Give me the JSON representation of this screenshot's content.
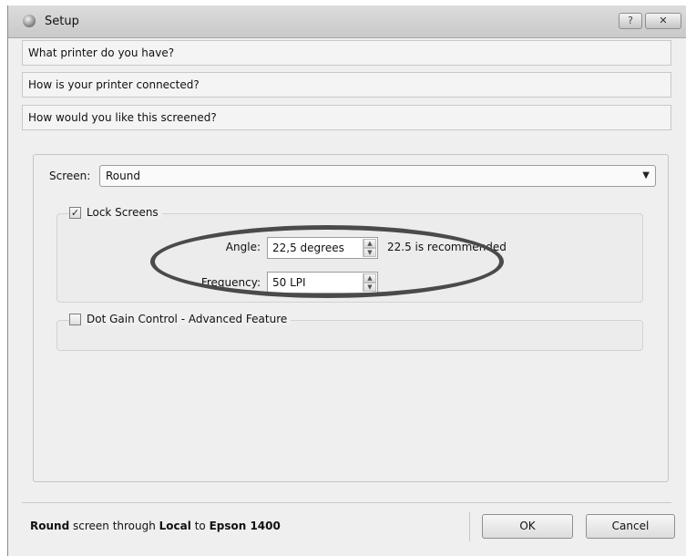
{
  "window": {
    "title": "Setup",
    "help_label": "?",
    "close_label": "✕"
  },
  "sections": [
    {
      "label": "What printer do you have?"
    },
    {
      "label": "How is your printer connected?"
    },
    {
      "label": "How would you like this screened?"
    }
  ],
  "screen": {
    "label": "Screen:",
    "selected": "Round",
    "dropdown_icon": "chevron-down-icon"
  },
  "lock_screens": {
    "label": "Lock Screens",
    "checked": true,
    "check_mark": "✓",
    "angle_label": "Angle:",
    "angle_value": "22,5 degrees",
    "angle_hint": "22.5 is recommended",
    "frequency_label": "Frequency:",
    "frequency_value": "50 LPI"
  },
  "dot_gain": {
    "label": "Dot Gain Control - Advanced Feature",
    "checked": false
  },
  "status": {
    "screen": "Round",
    "text1": " screen through ",
    "connection": "Local",
    "text2": " to ",
    "printer": "Epson 1400"
  },
  "buttons": {
    "ok": "OK",
    "cancel": "Cancel"
  },
  "colors": {
    "annotation_ellipse": "#4a4a4a"
  }
}
